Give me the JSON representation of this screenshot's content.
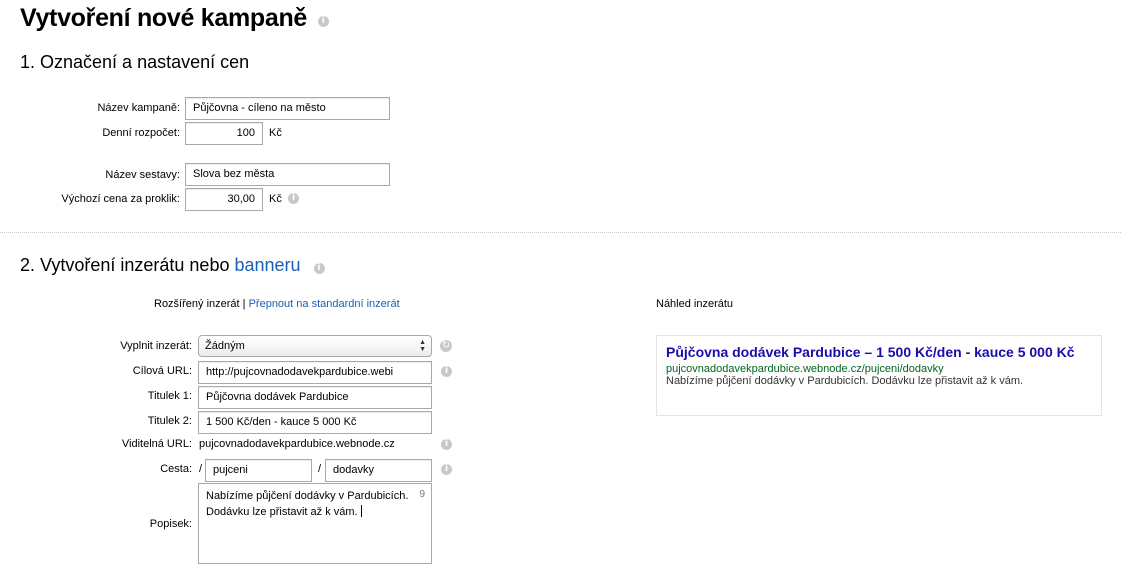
{
  "page": {
    "title": "Vytvoření nové kampaně"
  },
  "section1": {
    "heading": "1. Označení a nastavení cen",
    "campaign_name_label": "Název kampaně:",
    "campaign_name_value": "Půjčovna - cíleno na město",
    "daily_budget_label": "Denní rozpočet:",
    "daily_budget_value": "100",
    "daily_budget_unit": "Kč",
    "adgroup_name_label": "Název sestavy:",
    "adgroup_name_value": "Slova bez města",
    "default_cpc_label": "Výchozí cena za proklik:",
    "default_cpc_value": "30,00",
    "default_cpc_unit": "Kč"
  },
  "section2": {
    "heading_prefix": "2. Vytvoření inzerátu nebo",
    "heading_link": "banneru",
    "ad_type_current": "Rozšířený inzerát",
    "ad_type_separator": "|",
    "ad_type_switch_link": "Přepnout na standardní inzerát",
    "preview_label": "Náhled inzerátu",
    "fill_ad_label": "Vyplnit inzerát:",
    "fill_ad_selected": "Žádným",
    "target_url_label": "Cílová URL:",
    "target_url_value": "http://pujcovnadodavekpardubice.webi",
    "title1_label": "Titulek 1:",
    "title1_value": "Půjčovna dodávek Pardubice",
    "title2_label": "Titulek 2:",
    "title2_value": "1 500 Kč/den - kauce 5 000 Kč",
    "visible_url_label": "Viditelná URL:",
    "visible_url_value": "pujcovnadodavekpardubice.webnode.cz",
    "path_label": "Cesta:",
    "path_separator": "/",
    "path1_value": "pujceni",
    "path2_value": "dodavky",
    "description_label": "Popisek:",
    "description_line1": "Nabízíme půjčení dodávky v Pardubicích.",
    "description_line2": "Dodávku lze přistavit až k vám.",
    "description_counter": "9"
  },
  "preview": {
    "title": "Půjčovna dodávek Pardubice – 1 500 Kč/den - kauce 5 000 Kč",
    "url": "pujcovnadodavekpardubice.webnode.cz/pujceni/dodavky",
    "description": "Nabízíme půjčení dodávky v Pardubicích. Dodávku lze přistavit až k vám."
  },
  "icons": {
    "info": "info-icon",
    "reset": "reset-icon",
    "select_arrows": "select-arrows-icon"
  },
  "colors": {
    "link": "#1a5fb4",
    "preview_title": "#1a0dab",
    "preview_url": "#006621",
    "info_icon": "#c9c9c9"
  }
}
